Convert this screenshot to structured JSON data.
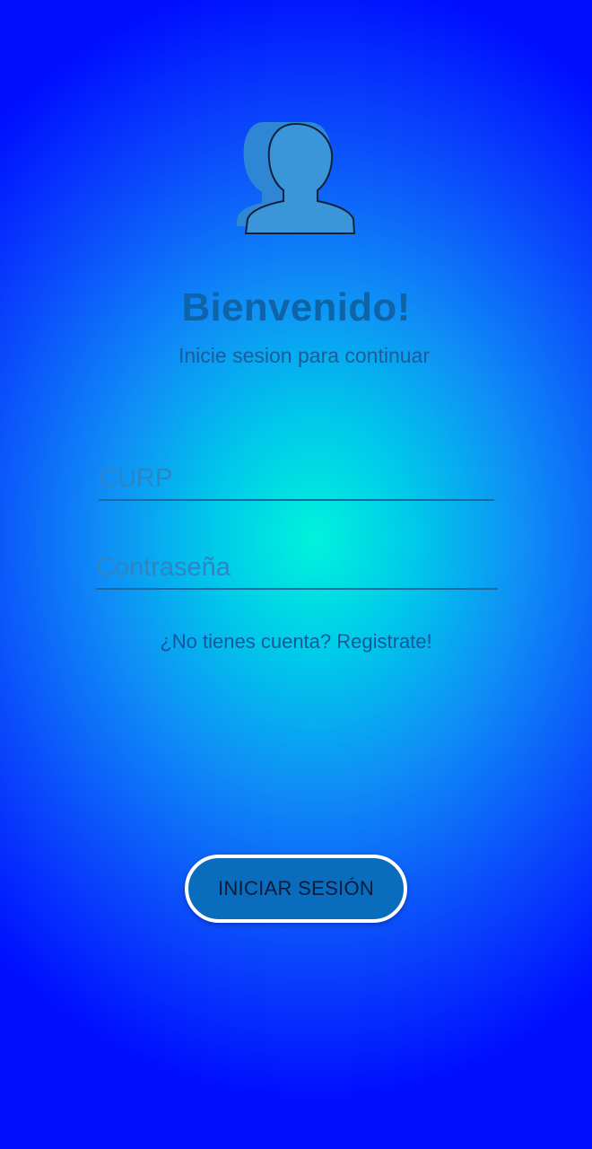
{
  "header": {
    "avatar_icon": "user-silhouette-icon",
    "title": "Bienvenido!",
    "subtitle": "Inicie sesion para continuar"
  },
  "form": {
    "curp": {
      "value": "",
      "placeholder": "CURP"
    },
    "password": {
      "value": "",
      "placeholder": "Contraseña"
    },
    "register_link": "¿No tienes cuenta? Registrate!",
    "submit_label": "INICIAR SESIÓN"
  },
  "colors": {
    "background_center": "#00f3dc",
    "background_edge": "#0010ff",
    "title": "#0f64a8",
    "button_fill": "#0a6cbc",
    "button_border": "#ffffff",
    "avatar_fill": "#3a96d8"
  }
}
